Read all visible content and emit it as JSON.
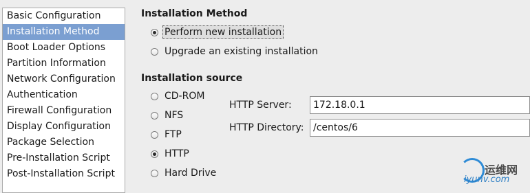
{
  "sidebar": {
    "items": [
      {
        "label": "Basic Configuration",
        "selected": false
      },
      {
        "label": "Installation Method",
        "selected": true
      },
      {
        "label": "Boot Loader Options",
        "selected": false
      },
      {
        "label": "Partition Information",
        "selected": false
      },
      {
        "label": "Network Configuration",
        "selected": false
      },
      {
        "label": "Authentication",
        "selected": false
      },
      {
        "label": "Firewall Configuration",
        "selected": false
      },
      {
        "label": "Display Configuration",
        "selected": false
      },
      {
        "label": "Package Selection",
        "selected": false
      },
      {
        "label": "Pre-Installation Script",
        "selected": false
      },
      {
        "label": "Post-Installation Script",
        "selected": false
      }
    ]
  },
  "install_method": {
    "title": "Installation Method",
    "options": [
      {
        "label": "Perform new installation",
        "checked": true
      },
      {
        "label": "Upgrade an existing installation",
        "checked": false
      }
    ]
  },
  "install_source": {
    "title": "Installation source",
    "options": [
      {
        "label": "CD-ROM",
        "checked": false
      },
      {
        "label": "NFS",
        "checked": false
      },
      {
        "label": "FTP",
        "checked": false
      },
      {
        "label": "HTTP",
        "checked": true
      },
      {
        "label": "Hard Drive",
        "checked": false
      }
    ],
    "http_server_label": "HTTP Server:",
    "http_server_value": "172.18.0.1",
    "http_directory_label": "HTTP Directory:",
    "http_directory_value": "/centos/6"
  },
  "watermark": {
    "text_cn": "运维网",
    "text_en": "iyunv.com"
  },
  "colors": {
    "selection": "#7b9fd1",
    "background": "#ededed",
    "watermark_blue": "#2e8bd6"
  }
}
